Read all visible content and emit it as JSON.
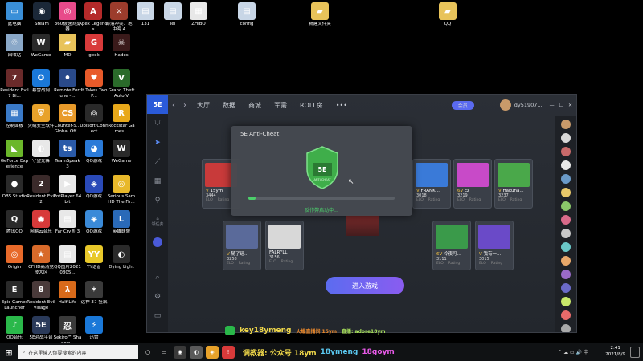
{
  "desktop": {
    "row_top": [
      {
        "label": "此电脑",
        "color": "#3a8fd8",
        "glyph": "▭"
      },
      {
        "label": "Steam",
        "color": "#1b2838",
        "glyph": "◉"
      },
      {
        "label": "360极速浏览器",
        "color": "#e84a8a",
        "glyph": "◎"
      },
      {
        "label": "Apex Legends",
        "color": "#b52a2a",
        "glyph": "A"
      },
      {
        "label": "部落冲突：地中海 4",
        "color": "#9c3c2c",
        "glyph": "⚔"
      },
      {
        "label": "131",
        "color": "#c8d6e6",
        "glyph": "▤"
      },
      {
        "label": "lei",
        "color": "#c8d6e6",
        "glyph": "▤"
      },
      {
        "label": "ZHIBO",
        "color": "#e8e8e8",
        "glyph": "▦"
      },
      {
        "label": "config",
        "color": "#c8d6e6",
        "glyph": "▤"
      },
      {
        "label": "新建文件夹",
        "color": "#e8c35a",
        "glyph": "▰"
      },
      {
        "label": "QQ",
        "color": "#e8c35a",
        "glyph": "▰"
      }
    ],
    "col1": [
      {
        "label": "回收站",
        "color": "#8aa8c8",
        "glyph": "♲"
      },
      {
        "label": "Resident Evil 7 Bi...",
        "color": "#6a2a2a",
        "glyph": "7"
      },
      {
        "label": "控制面板",
        "color": "#3a7ac8",
        "glyph": "▦"
      },
      {
        "label": "GeForce Experience",
        "color": "#6bb72a",
        "glyph": "◣"
      },
      {
        "label": "OBS Studio",
        "color": "#2a2a2a",
        "glyph": "●"
      },
      {
        "label": "腾讯QQ",
        "color": "#2a2a2a",
        "glyph": "Q"
      },
      {
        "label": "Origin",
        "color": "#e86a2a",
        "glyph": "◎"
      },
      {
        "label": "Epic Games Launcher",
        "color": "#2a2a2a",
        "glyph": "E"
      },
      {
        "label": "QQ音乐",
        "color": "#2ab84a",
        "glyph": "♪"
      }
    ],
    "col2": [
      {
        "label": "WeGame",
        "color": "#2a2a2a",
        "glyph": "W"
      },
      {
        "label": "暴雪战网",
        "color": "#1a78d8",
        "glyph": "✪"
      },
      {
        "label": "火绒安全软件",
        "color": "#e8a22a",
        "glyph": "⛨"
      },
      {
        "label": "守望先锋",
        "color": "#e8e8e8",
        "glyph": "◐"
      },
      {
        "label": "Resident Evil 2",
        "color": "#3a2a2a",
        "glyph": "2"
      },
      {
        "label": "网易云音乐",
        "color": "#d83a3a",
        "glyph": "◉"
      },
      {
        "label": "CFHD高清竞技大区",
        "color": "#d86a2a",
        "glyph": "★"
      },
      {
        "label": "Resident Evil Village",
        "color": "#4a3a3a",
        "glyph": "8"
      },
      {
        "label": "5E对战平台",
        "color": "#2a3a5a",
        "glyph": "5E"
      }
    ],
    "col3": [
      {
        "label": "MD",
        "color": "#e8c35a",
        "glyph": "▰"
      },
      {
        "label": "Remote Fortune -...",
        "color": "#2a4a8a",
        "glyph": "⚫"
      },
      {
        "label": "Counter-S... Global Off...",
        "color": "#e89a2a",
        "glyph": "CS"
      },
      {
        "label": "TeamSpeak 3",
        "color": "#2a5aa8",
        "glyph": "ts"
      },
      {
        "label": "PotPlayer 64 bit",
        "color": "#e8e8e8",
        "glyph": "▶"
      },
      {
        "label": "Far Cry® 3",
        "color": "#e8e8e8",
        "glyph": "▤"
      },
      {
        "label": "QQ图片20210805...",
        "color": "#e8e8e8",
        "glyph": "▤"
      },
      {
        "label": "Half-Life",
        "color": "#d86a1a",
        "glyph": "λ"
      },
      {
        "label": "Sekiro™ Shadow...",
        "color": "#3a3a3a",
        "glyph": "忍"
      }
    ],
    "col4": [
      {
        "label": "geek",
        "color": "#d83a3a",
        "glyph": "G"
      },
      {
        "label": "It Takes Two P...",
        "color": "#e85a2a",
        "glyph": "♥"
      },
      {
        "label": "Ubisoft Connect",
        "color": "#2a2a2a",
        "glyph": "◎"
      },
      {
        "label": "QQ游戏",
        "color": "#2a7ad8",
        "glyph": "◕"
      },
      {
        "label": "QQ游戏",
        "color": "#2a4ab8",
        "glyph": "◈"
      },
      {
        "label": "QQ游戏",
        "color": "#3a8ad8",
        "glyph": "◈"
      },
      {
        "label": "YY语音",
        "color": "#e8c82a",
        "glyph": "YY"
      },
      {
        "label": "远神 3：狂飙",
        "color": "#3a3a3a",
        "glyph": "✶"
      },
      {
        "label": "迅雷",
        "color": "#1a78d8",
        "glyph": "⚡"
      }
    ],
    "col5": [
      {
        "label": "Hades",
        "color": "#3a1a1a",
        "glyph": "☠"
      },
      {
        "label": "Grand Theft Auto V",
        "color": "#2a6a2a",
        "glyph": "V"
      },
      {
        "label": "Rockstar Games...",
        "color": "#e8a81a",
        "glyph": "R"
      },
      {
        "label": "WeGame",
        "color": "#2a2a2a",
        "glyph": "W"
      },
      {
        "label": "Serious Sam HD The Fir...",
        "color": "#e8b82a",
        "glyph": "◎"
      },
      {
        "label": "英雄联盟",
        "color": "#2a6ab8",
        "glyph": "L"
      },
      {
        "label": "Dying Light",
        "color": "#2a2a2a",
        "glyph": "◐"
      }
    ]
  },
  "app": {
    "logo": "5E",
    "nav": [
      "大厅",
      "数据",
      "商城",
      "军需",
      "ROLL房",
      "•••"
    ],
    "vip_badge": "会员",
    "username": "dy51907...",
    "sidebar_label": "领任务",
    "window_controls": [
      "—",
      "☐",
      "✕"
    ],
    "enter_button": "进入游戏",
    "team_left": [
      {
        "name": "15ym",
        "elo": "3444",
        "prefix": "V",
        "elo_label": "ELO",
        "rating_label": "Rating",
        "color": "#c83a3a"
      },
      {
        "name": "随了瑶...",
        "elo": "3258",
        "prefix": "V",
        "elo_label": "ELO",
        "rating_label": "Rating",
        "color": "#5a6a9a"
      },
      {
        "name": "FALRYLL",
        "elo": "3156",
        "prefix": "",
        "elo_label": "ELO",
        "rating_label": "Rating",
        "color": "#d8d8d8"
      }
    ],
    "team_right": [
      {
        "name": "FRANK...",
        "elo": "3018",
        "prefix": "V",
        "elo_label": "ELO",
        "rating_label": "Rating",
        "color": "#3a7ad8"
      },
      {
        "name": "cz",
        "elo": "3219",
        "prefix": "6V",
        "elo_label": "ELO",
        "rating_label": "Rating",
        "color": "#c84ac8"
      },
      {
        "name": "Hakuna...",
        "elo": "3237",
        "prefix": "V",
        "elo_label": "ELO",
        "rating_label": "Rating",
        "color": "#4aa84a"
      },
      {
        "name": "冷夜可...",
        "elo": "3111",
        "prefix": "6V",
        "elo_label": "ELO",
        "rating_label": "Rating",
        "color": "#3a9a4a"
      },
      {
        "name": "我有一...",
        "elo": "3015",
        "prefix": "V",
        "elo_label": "ELO",
        "rating_label": "Rating",
        "color": "#6a4ac8"
      }
    ]
  },
  "anticheat": {
    "title": "5E Anti-Cheat",
    "shield_text": "5E",
    "shield_sub": "ANTI-CHEAT",
    "status": "反作弊启动中...",
    "progress": 0.05
  },
  "banner": {
    "wechat": "key18ymeng",
    "mid": "火爆直播间 15ym",
    "right": "直播: adore18ym"
  },
  "taskbar": {
    "search_placeholder": "在这里输入你要搜索的内容",
    "overlay_left": "调教器: 公众号 18ym",
    "overlay_mid": "18ymeng",
    "overlay_right": "18goym",
    "time": "2:41",
    "date": "2021/8/9",
    "lang": "中"
  }
}
